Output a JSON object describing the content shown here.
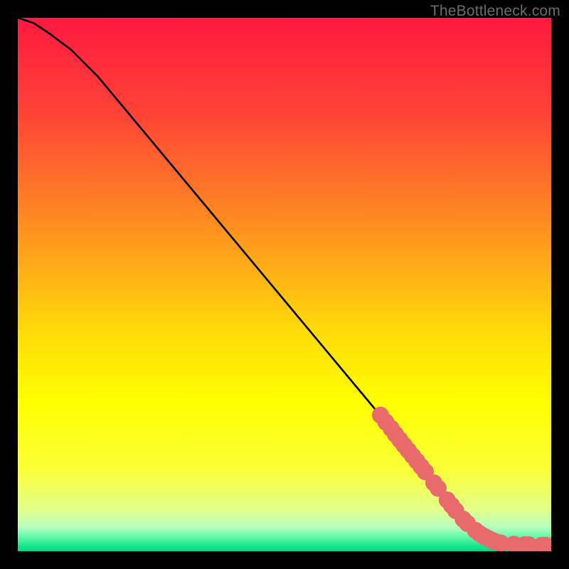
{
  "watermark": "TheBottleneck.com",
  "chart_data": {
    "type": "line",
    "title": "",
    "xlabel": "",
    "ylabel": "",
    "xlim": [
      0,
      100
    ],
    "ylim": [
      0,
      100
    ],
    "grid": false,
    "series": [
      {
        "name": "curve",
        "x": [
          0,
          3,
          6,
          10,
          15,
          20,
          30,
          40,
          50,
          60,
          70,
          78,
          82,
          85,
          88,
          92,
          96,
          100
        ],
        "y": [
          100,
          99,
          97,
          94,
          89,
          83,
          71,
          59,
          47,
          35,
          23,
          13,
          8,
          5,
          3,
          1.5,
          1.2,
          1.1
        ]
      }
    ],
    "markers": [
      {
        "x": 68.0,
        "y": 25.5,
        "r": 1.6
      },
      {
        "x": 69.0,
        "y": 24.2,
        "r": 1.6
      },
      {
        "x": 70.0,
        "y": 23.0,
        "r": 1.6
      },
      {
        "x": 70.8,
        "y": 21.9,
        "r": 1.6
      },
      {
        "x": 71.6,
        "y": 20.9,
        "r": 1.6
      },
      {
        "x": 72.4,
        "y": 19.9,
        "r": 1.6
      },
      {
        "x": 73.2,
        "y": 18.9,
        "r": 1.6
      },
      {
        "x": 74.0,
        "y": 17.9,
        "r": 1.6
      },
      {
        "x": 74.8,
        "y": 16.9,
        "r": 1.6
      },
      {
        "x": 75.6,
        "y": 15.9,
        "r": 1.6
      },
      {
        "x": 76.4,
        "y": 14.9,
        "r": 1.6
      },
      {
        "x": 78.0,
        "y": 12.8,
        "r": 1.6
      },
      {
        "x": 78.8,
        "y": 11.8,
        "r": 1.6
      },
      {
        "x": 80.5,
        "y": 9.6,
        "r": 1.6
      },
      {
        "x": 81.3,
        "y": 8.6,
        "r": 1.6
      },
      {
        "x": 82.1,
        "y": 7.6,
        "r": 1.6
      },
      {
        "x": 83.5,
        "y": 6.0,
        "r": 1.6
      },
      {
        "x": 84.3,
        "y": 5.2,
        "r": 1.6
      },
      {
        "x": 85.8,
        "y": 3.9,
        "r": 1.6
      },
      {
        "x": 86.6,
        "y": 3.3,
        "r": 1.6
      },
      {
        "x": 87.4,
        "y": 2.8,
        "r": 1.6
      },
      {
        "x": 88.2,
        "y": 2.4,
        "r": 1.6
      },
      {
        "x": 89.0,
        "y": 2.0,
        "r": 1.6
      },
      {
        "x": 89.8,
        "y": 1.7,
        "r": 1.6
      },
      {
        "x": 90.6,
        "y": 1.5,
        "r": 1.6
      },
      {
        "x": 93.0,
        "y": 1.3,
        "r": 1.6
      },
      {
        "x": 95.0,
        "y": 1.2,
        "r": 1.6
      },
      {
        "x": 95.8,
        "y": 1.2,
        "r": 1.6
      },
      {
        "x": 98.2,
        "y": 1.1,
        "r": 1.6
      },
      {
        "x": 99.0,
        "y": 1.1,
        "r": 1.6
      }
    ],
    "background": {
      "type": "vertical-gradient",
      "stops": [
        {
          "offset": 0.0,
          "color": "#ff193f"
        },
        {
          "offset": 0.18,
          "color": "#ff4336"
        },
        {
          "offset": 0.38,
          "color": "#ff8b22"
        },
        {
          "offset": 0.58,
          "color": "#ffd80a"
        },
        {
          "offset": 0.72,
          "color": "#ffff00"
        },
        {
          "offset": 0.85,
          "color": "#faff3a"
        },
        {
          "offset": 0.92,
          "color": "#e3ff8a"
        },
        {
          "offset": 0.955,
          "color": "#b7ffc0"
        },
        {
          "offset": 0.975,
          "color": "#5ef7a6"
        },
        {
          "offset": 0.99,
          "color": "#17e58e"
        },
        {
          "offset": 1.0,
          "color": "#00d884"
        }
      ]
    },
    "marker_color": "#e86a6a",
    "curve_color": "#000000"
  }
}
